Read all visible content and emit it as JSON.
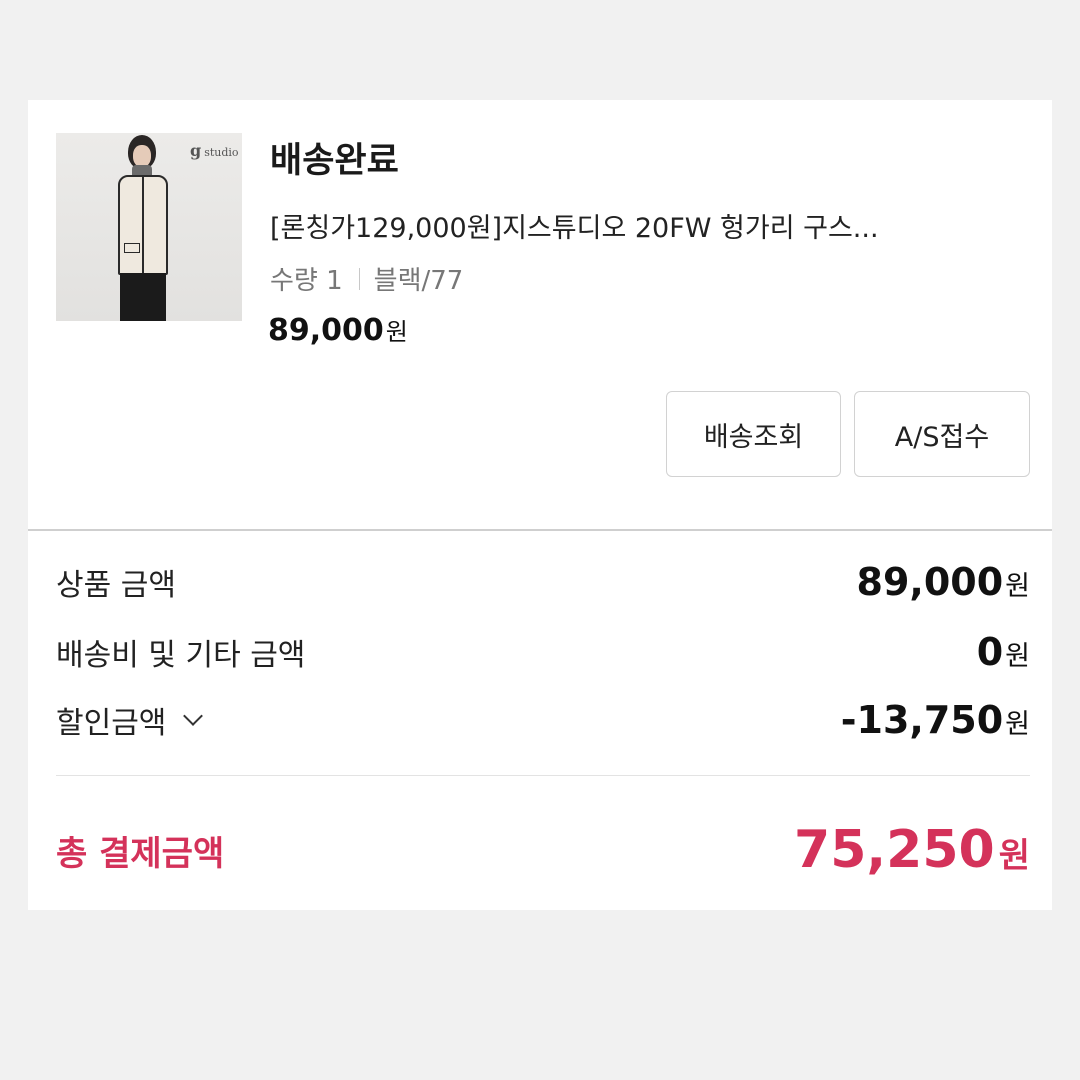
{
  "order": {
    "status": "배송완료",
    "product": {
      "image_brand_text": "studio",
      "image_brand_mark": "g",
      "title": "[론칭가129,000원]지스튜디오 20FW 헝가리 구스...",
      "quantity_label": "수량 1",
      "option": "블랙/77",
      "price": "89,000",
      "price_unit": "원"
    },
    "buttons": {
      "track": "배송조회",
      "as": "A/S접수"
    }
  },
  "summary": {
    "product_amount": {
      "label": "상품 금액",
      "value": "89,000",
      "unit": "원"
    },
    "shipping": {
      "label": "배송비 및 기타 금액",
      "value": "0",
      "unit": "원"
    },
    "discount": {
      "label": "할인금액",
      "value": "-13,750",
      "unit": "원",
      "icon": "chevron-down-icon"
    },
    "total": {
      "label": "총 결제금액",
      "value": "75,250",
      "unit": "원"
    }
  },
  "colors": {
    "accent": "#d4325a",
    "background": "#f1f1f1"
  }
}
